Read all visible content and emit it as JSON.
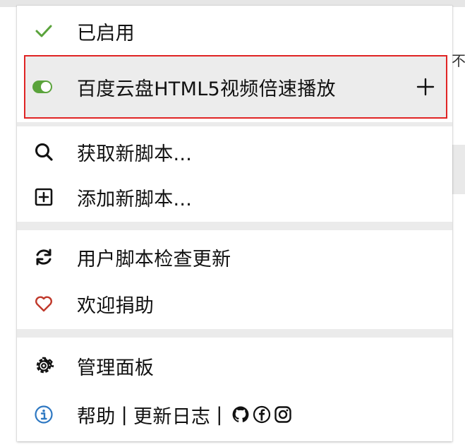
{
  "menu": {
    "enabled_label": "已启用",
    "script": {
      "name": "百度云盘HTML5视频倍速播放",
      "enabled": true
    },
    "get_new_scripts": "获取新脚本...",
    "add_new_script": "添加新脚本...",
    "check_updates": "用户脚本检查更新",
    "donate": "欢迎捐助",
    "dashboard": "管理面板",
    "footer": {
      "help": "帮助",
      "separator": "|",
      "changelog": "更新日志"
    }
  },
  "background": {
    "clipped_text": "不"
  },
  "colors": {
    "check": "#5aa33b",
    "toggle_on": "#5aa33b",
    "highlight_border": "#e02424",
    "heart": "#c0392b",
    "info": "#2e78c2"
  },
  "icons": {
    "enabled": "check-icon",
    "toggle": "toggle-on-icon",
    "add_to_script": "plus-icon",
    "search": "search-icon",
    "add": "plus-square-icon",
    "refresh": "refresh-icon",
    "heart": "heart-icon",
    "gear": "gear-icon",
    "info": "info-icon",
    "github": "github-icon",
    "facebook": "facebook-icon",
    "instagram": "instagram-icon"
  }
}
